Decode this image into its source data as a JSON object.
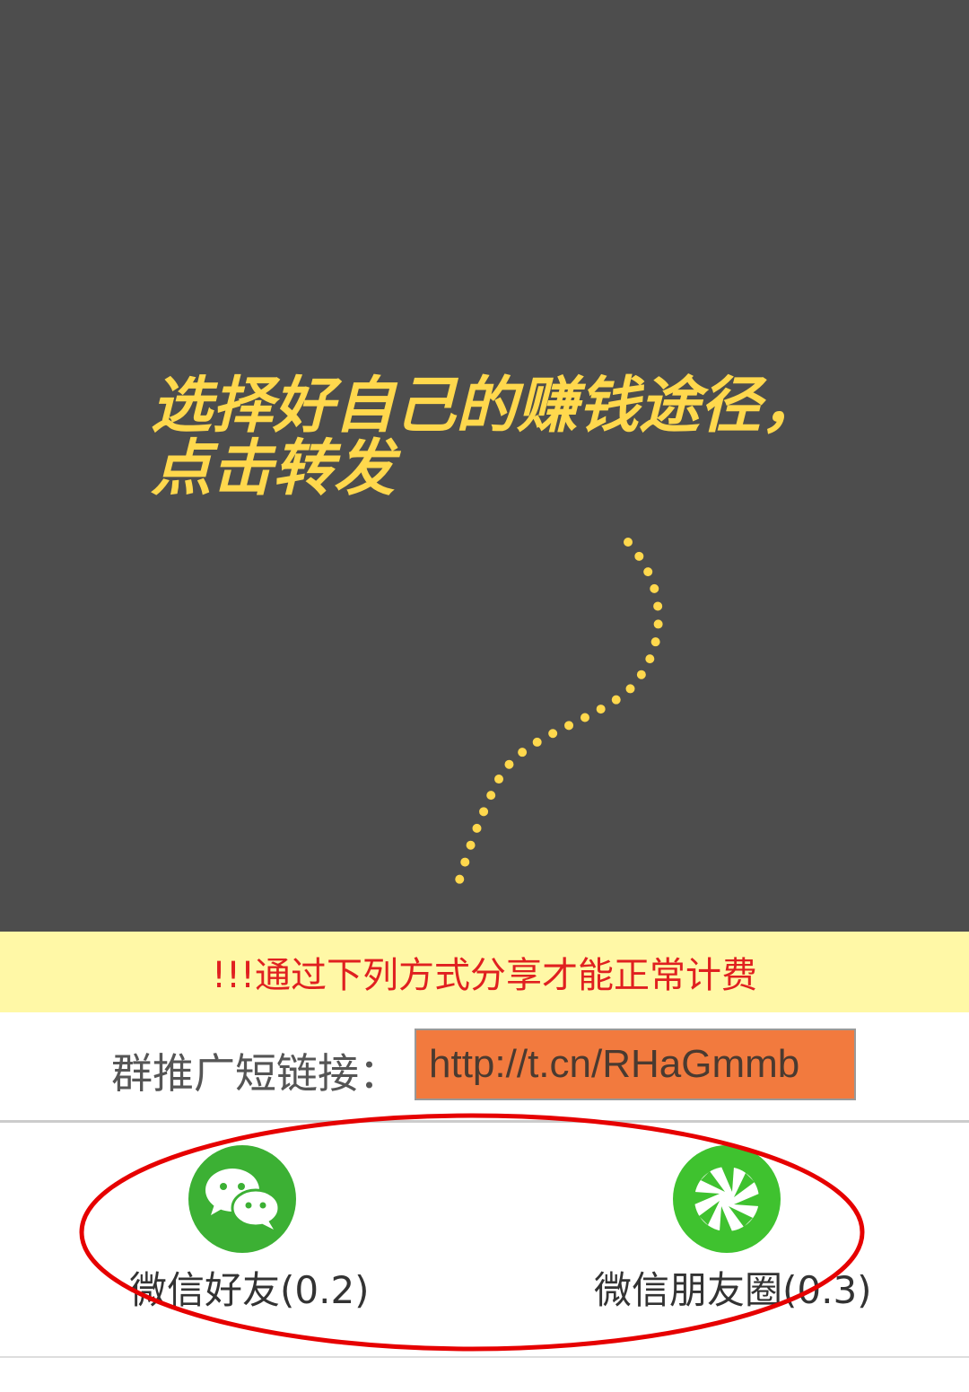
{
  "overlay": {
    "guide_text": "选择好自己的赚钱途径，\n点击转发"
  },
  "notice": {
    "text": "!!!通过下列方式分享才能正常计费"
  },
  "short_link": {
    "label": "群推广短链接：",
    "value": "http://t.cn/RHaGmmb"
  },
  "share": {
    "options": [
      {
        "label": "微信好友(0.2)",
        "icon": "wechat-icon",
        "color": "#3cb034"
      },
      {
        "label": "微信朋友圈(0.3)",
        "icon": "moments-icon",
        "color": "#3fc22f"
      }
    ]
  },
  "colors": {
    "overlay": "#4d4d4d",
    "guide_text": "#ffd84d",
    "notice_bg": "#fff8a6",
    "notice_text": "#e02020",
    "link_bg": "#f27a3e",
    "highlight_ellipse": "#e60000"
  }
}
